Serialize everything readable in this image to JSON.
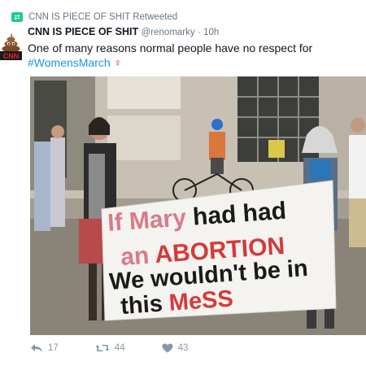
{
  "retweet": {
    "icon": "retweet-icon",
    "text": "CNN IS PIECE OF SHIT Retweeted"
  },
  "tweet": {
    "author_name": "CNN IS PIECE OF SHIT",
    "handle": "@renomarky",
    "separator": " · ",
    "time": "10h",
    "text": "One of many reasons normal people have no respect for",
    "hashtag": "#WomensMarch",
    "emoji": "♀"
  },
  "avatar": {
    "icon": "poop-emoji-icon",
    "label": "CNN"
  },
  "photo": {
    "banner_lines": [
      {
        "words": [
          {
            "t": "If Mary",
            "c": "#d87a8a"
          },
          {
            "t": "had had",
            "c": "#1a1a1a"
          }
        ]
      },
      {
        "words": [
          {
            "t": "an",
            "c": "#d87a8a"
          },
          {
            "t": "ABORTION",
            "c": "#d43a3a"
          }
        ]
      },
      {
        "words": [
          {
            "t": "We wouldn't be in",
            "c": "#1a1a1a"
          }
        ]
      },
      {
        "words": [
          {
            "t": "this",
            "c": "#1a1a1a"
          },
          {
            "t": "MeSS",
            "c": "#d43a3a"
          }
        ]
      }
    ]
  },
  "actions": {
    "reply_count": "17",
    "retweet_count": "44",
    "like_count": "43"
  },
  "colors": {
    "retweet_green": "#19cf86",
    "hashtag_blue": "#1b95e0",
    "muted": "#657786",
    "venus_pink": "#e0245e"
  }
}
